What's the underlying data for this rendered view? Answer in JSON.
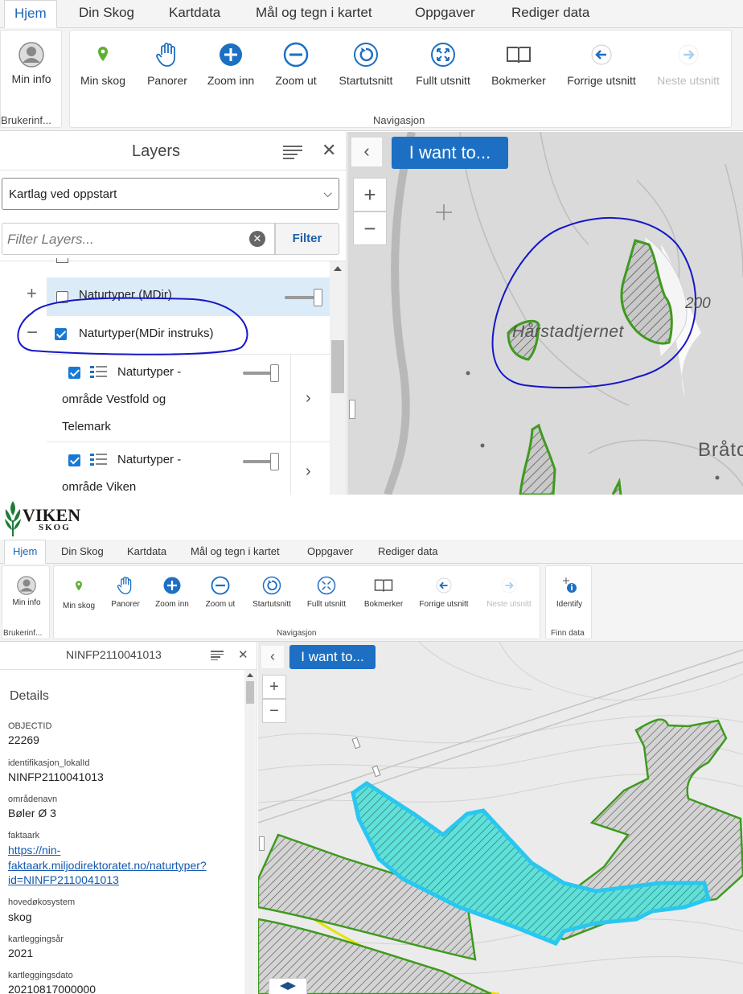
{
  "top": {
    "tabs": [
      "Hjem",
      "Din Skog",
      "Kartdata",
      "Mål og tegn i kartet",
      "Oppgaver",
      "Rediger data"
    ],
    "ribbon": {
      "user_label": "Min info",
      "user_group": "Brukerinf...",
      "nav_buttons": [
        "Min skog",
        "Panorer",
        "Zoom inn",
        "Zoom ut",
        "Startutsnitt",
        "Fullt utsnitt",
        "Bokmerker",
        "Forrige utsnitt",
        "Neste utsnitt"
      ],
      "nav_group": "Navigasjon"
    },
    "layers_panel": {
      "title": "Layers",
      "select_value": "Kartlag ved oppstart",
      "filter_placeholder": "Filter Layers...",
      "filter_button": "Filter",
      "items": [
        {
          "label": "Naturtyper (MDir)",
          "checked": false,
          "expander": "+"
        },
        {
          "label": "Naturtyper(MDir instruks)",
          "checked": true,
          "expander": "−"
        },
        {
          "label": "Naturtyper - område Vestfold og Telemark",
          "checked": true
        },
        {
          "label": "Naturtyper - område Viken",
          "checked": true
        }
      ],
      "sublines": [
        "Naturtyper -",
        "område Vestfold og",
        "Telemark",
        "Naturtyper -",
        "område Viken"
      ]
    },
    "map": {
      "i_want_to": "I want to...",
      "labels": [
        "Hårstadtjernet",
        "200",
        "Bråto"
      ]
    }
  },
  "bottom": {
    "logo": {
      "line1": "VIKEN",
      "line2": "SKOG"
    },
    "tabs": [
      "Hjem",
      "Din Skog",
      "Kartdata",
      "Mål og tegn i kartet",
      "Oppgaver",
      "Rediger data"
    ],
    "ribbon": {
      "user_label": "Min info",
      "user_group": "Brukerinf...",
      "nav_buttons": [
        "Min skog",
        "Panorer",
        "Zoom inn",
        "Zoom ut",
        "Startutsnitt",
        "Fullt utsnitt",
        "Bokmerker",
        "Forrige utsnitt",
        "Neste utsnitt"
      ],
      "nav_group": "Navigasjon",
      "identify_label": "Identify",
      "identify_group": "Finn data"
    },
    "details_panel": {
      "title": "NINFP2110041013",
      "heading": "Details",
      "fields": [
        {
          "label": "OBJECTID",
          "value": "22269"
        },
        {
          "label": "identifikasjon_lokalId",
          "value": "NINFP2110041013"
        },
        {
          "label": "områdenavn",
          "value": "Bøler Ø 3"
        },
        {
          "label": "faktaark",
          "value_lines": [
            "https://nin-",
            "faktaark.miljodirektoratet.no/naturtyper?",
            "id=NINFP2110041013"
          ]
        },
        {
          "label": "hovedøkosystem",
          "value": "skog"
        },
        {
          "label": "kartleggingsår",
          "value": "2021"
        },
        {
          "label": "kartleggingsdato",
          "value": "20210817000000"
        }
      ]
    },
    "map": {
      "i_want_to": "I want to..."
    }
  },
  "colors": {
    "accent": "#1d6fc3",
    "polygon_green": "#3f9a1e",
    "highlight": "#29c7f0",
    "annotation_blue": "#1616c8"
  }
}
